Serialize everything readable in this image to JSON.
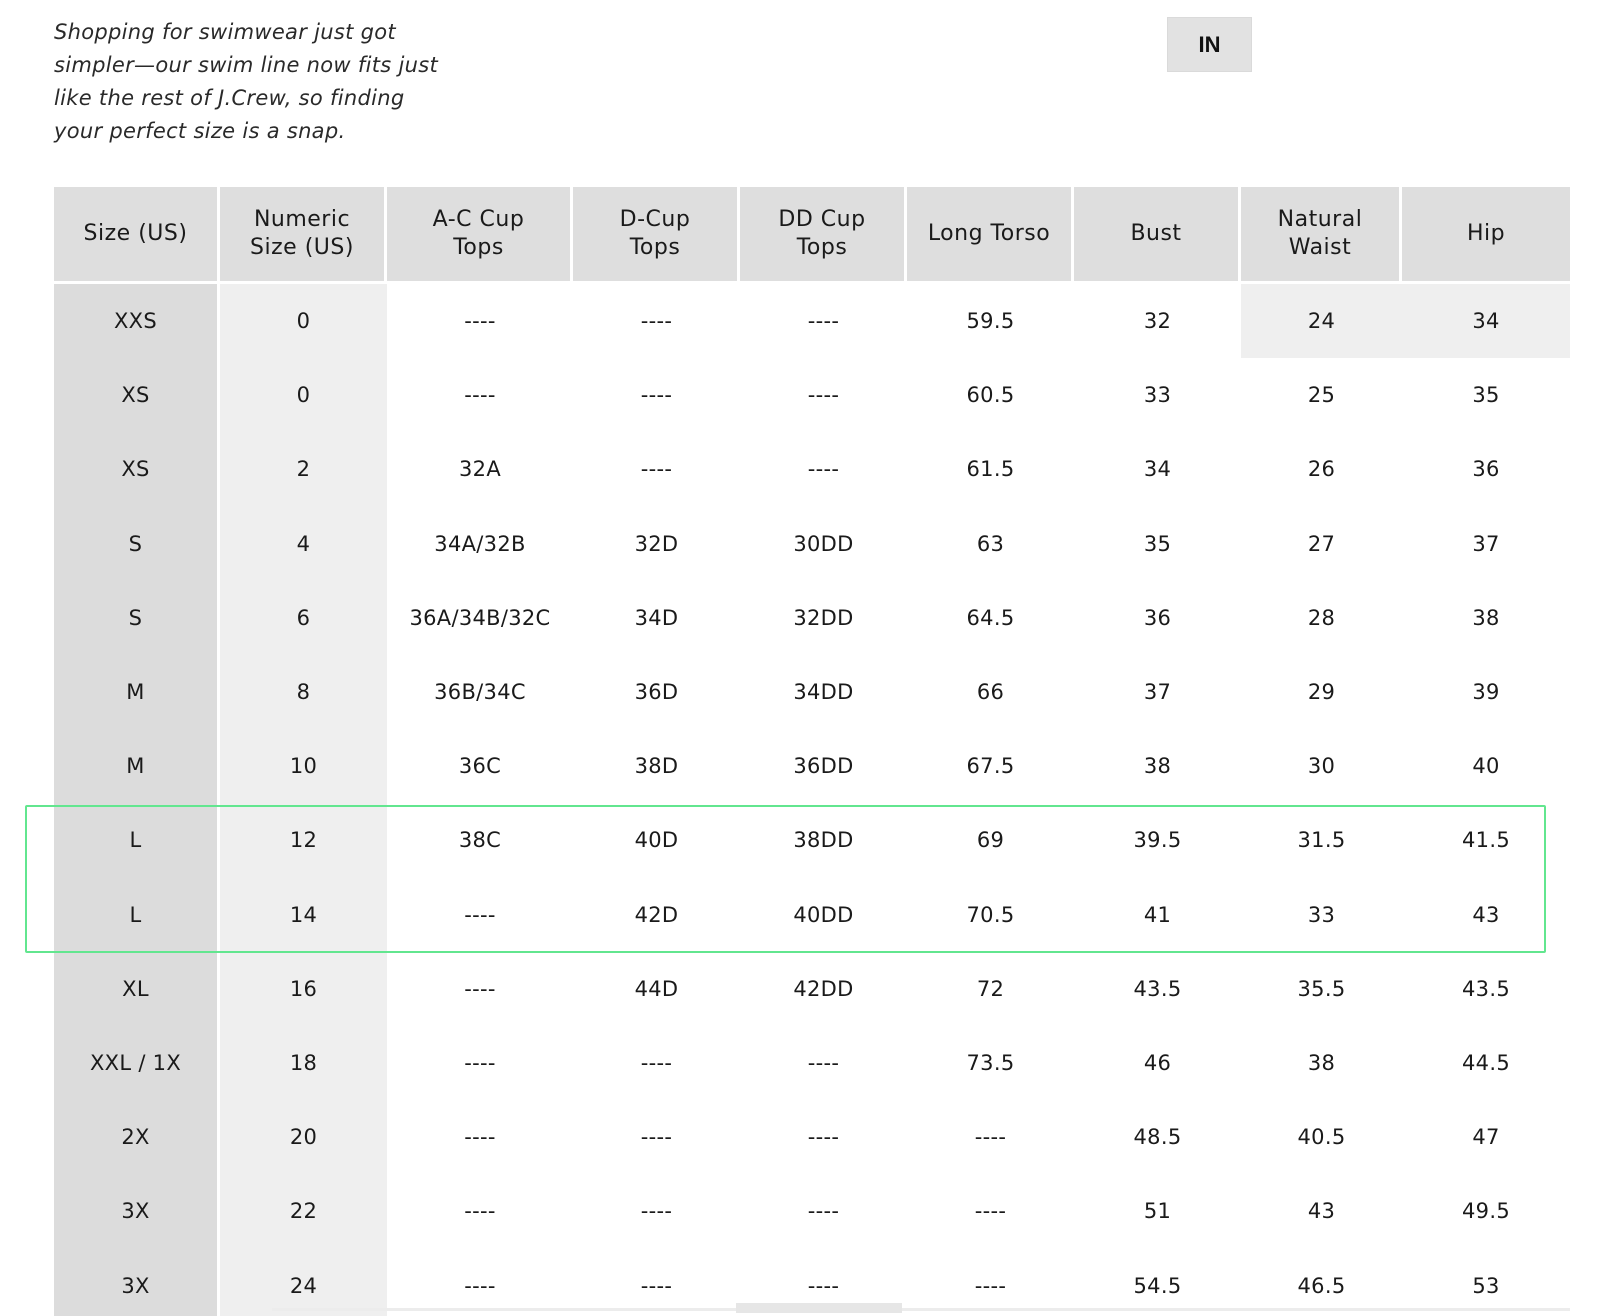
{
  "intro": {
    "line1": "Shopping for swimwear just got",
    "line2": "simpler—our swim line now fits just",
    "line3": "like the rest of J.Crew, so finding",
    "line4": "your perfect size is a snap."
  },
  "unit_toggle": {
    "label": "IN"
  },
  "table": {
    "headers": {
      "size": "Size (US)",
      "numeric_1": "Numeric",
      "numeric_2": "Size (US)",
      "ac_1": "A-C Cup",
      "ac_2": "Tops",
      "d_1": "D-Cup",
      "d_2": "Tops",
      "dd_1": "DD Cup",
      "dd_2": "Tops",
      "torso": "Long Torso",
      "bust": "Bust",
      "waist_1": "Natural",
      "waist_2": "Waist",
      "hip": "Hip"
    },
    "rows": [
      {
        "size": "XXS",
        "numeric": "0",
        "ac": "----",
        "d": "----",
        "dd": "----",
        "torso": "59.5",
        "bust": "32",
        "waist": "24",
        "hip": "34"
      },
      {
        "size": "XS",
        "numeric": "0",
        "ac": "----",
        "d": "----",
        "dd": "----",
        "torso": "60.5",
        "bust": "33",
        "waist": "25",
        "hip": "35"
      },
      {
        "size": "XS",
        "numeric": "2",
        "ac": "32A",
        "d": "----",
        "dd": "----",
        "torso": "61.5",
        "bust": "34",
        "waist": "26",
        "hip": "36"
      },
      {
        "size": "S",
        "numeric": "4",
        "ac": "34A/32B",
        "d": "32D",
        "dd": "30DD",
        "torso": "63",
        "bust": "35",
        "waist": "27",
        "hip": "37"
      },
      {
        "size": "S",
        "numeric": "6",
        "ac": "36A/34B/32C",
        "d": "34D",
        "dd": "32DD",
        "torso": "64.5",
        "bust": "36",
        "waist": "28",
        "hip": "38"
      },
      {
        "size": "M",
        "numeric": "8",
        "ac": "36B/34C",
        "d": "36D",
        "dd": "34DD",
        "torso": "66",
        "bust": "37",
        "waist": "29",
        "hip": "39"
      },
      {
        "size": "M",
        "numeric": "10",
        "ac": "36C",
        "d": "38D",
        "dd": "36DD",
        "torso": "67.5",
        "bust": "38",
        "waist": "30",
        "hip": "40"
      },
      {
        "size": "L",
        "numeric": "12",
        "ac": "38C",
        "d": "40D",
        "dd": "38DD",
        "torso": "69",
        "bust": "39.5",
        "waist": "31.5",
        "hip": "41.5"
      },
      {
        "size": "L",
        "numeric": "14",
        "ac": "----",
        "d": "42D",
        "dd": "40DD",
        "torso": "70.5",
        "bust": "41",
        "waist": "33",
        "hip": "43"
      },
      {
        "size": "XL",
        "numeric": "16",
        "ac": "----",
        "d": "44D",
        "dd": "42DD",
        "torso": "72",
        "bust": "43.5",
        "waist": "35.5",
        "hip": "43.5"
      },
      {
        "size": "XXL / 1X",
        "numeric": "18",
        "ac": "----",
        "d": "----",
        "dd": "----",
        "torso": "73.5",
        "bust": "46",
        "waist": "38",
        "hip": "44.5"
      },
      {
        "size": "2X",
        "numeric": "20",
        "ac": "----",
        "d": "----",
        "dd": "----",
        "torso": "----",
        "bust": "48.5",
        "waist": "40.5",
        "hip": "47"
      },
      {
        "size": "3X",
        "numeric": "22",
        "ac": "----",
        "d": "----",
        "dd": "----",
        "torso": "----",
        "bust": "51",
        "waist": "43",
        "hip": "49.5"
      },
      {
        "size": "3X",
        "numeric": "24",
        "ac": "----",
        "d": "----",
        "dd": "----",
        "torso": "----",
        "bust": "54.5",
        "waist": "46.5",
        "hip": "53"
      }
    ]
  },
  "colors": {
    "header_bg": "#dedede",
    "size_col_bg": "#dcdcdc",
    "numeric_col_bg": "#efefef",
    "highlight": "#62e68f"
  }
}
